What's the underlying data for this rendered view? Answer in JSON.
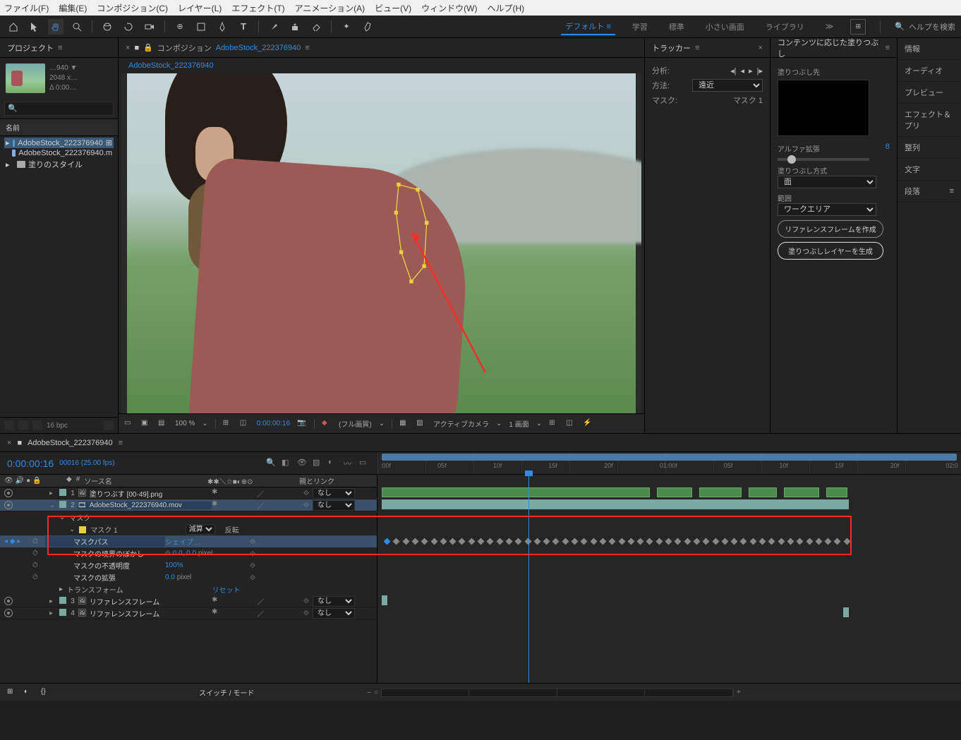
{
  "menu": {
    "file": "ファイル(F)",
    "edit": "編集(E)",
    "comp": "コンポジション(C)",
    "layer": "レイヤー(L)",
    "effect": "エフェクト(T)",
    "anim": "アニメーション(A)",
    "view": "ビュー(V)",
    "window": "ウィンドウ(W)",
    "help": "ヘルプ(H)"
  },
  "workspace": {
    "default": "デフォルト",
    "learn": "学習",
    "standard": "標準",
    "small": "小さい画面",
    "library": "ライブラリ",
    "search_ph": "ヘルプを検索"
  },
  "project": {
    "title": "プロジェクト",
    "name_trunc": "…940 ▼",
    "dim": "2048 x…",
    "dur": "Δ 0:00…",
    "col_name": "名前",
    "items": [
      {
        "label": "AdobeStock_222376940",
        "sel": true,
        "kind": "comp"
      },
      {
        "label": "AdobeStock_222376940.m",
        "kind": "img"
      },
      {
        "label": "塗りのスタイル",
        "kind": "folder"
      }
    ],
    "bpc": "16 bpc"
  },
  "comp": {
    "prefix": "コンポジション",
    "name": "AdobeStock_222376940",
    "tab_name": "AdobeStock_222376940"
  },
  "viewer_ctrl": {
    "zoom": "100 %",
    "time": "0:00:00:16",
    "quality": "(フル画質)",
    "camera": "アクティブカメラ",
    "views": "1 画面"
  },
  "tracker": {
    "title": "トラッカー",
    "analysis": "分析:",
    "method": "方法:",
    "method_val": "遠近",
    "mask": "マスク:",
    "mask_val": "マスク 1"
  },
  "fill": {
    "title": "コンテンツに応じた塗りつぶし",
    "target": "塗りつぶし先",
    "alpha": "アルファ拡張",
    "alpha_val": "8",
    "method": "塗りつぶし方式",
    "method_val": "面",
    "range": "範囲",
    "range_val": "ワークエリア",
    "btn_ref": "リファレンスフレームを作成",
    "btn_gen": "塗りつぶしレイヤーを生成"
  },
  "right_tabs": [
    "情報",
    "オーディオ",
    "プレビュー",
    "エフェクト＆プリ",
    "整列",
    "文字",
    "段落"
  ],
  "timeline": {
    "tab": "AdobeStock_222376940",
    "time": "0:00:00:16",
    "frame": "00016 (25.00 fps)",
    "ticks": [
      ":00f",
      "05f",
      "10f",
      "15f",
      "20f",
      "01:00f",
      "05f",
      "10f",
      "15f",
      "20f",
      "02:0"
    ],
    "cols": {
      "source": "ソース名",
      "switches_l": "",
      "link": "親とリンク"
    },
    "none": "なし",
    "layers": [
      {
        "n": "1",
        "name": "塗りつぶす [00-49].png",
        "icon": "seq"
      },
      {
        "n": "2",
        "name": "AdobeStock_222376940.mov",
        "icon": "mov",
        "sel": true
      },
      {
        "n": "3",
        "name": "リファレンスフレーム",
        "icon": "ref"
      },
      {
        "n": "4",
        "name": "リファレンスフレーム",
        "icon": "ref"
      }
    ],
    "mask_group": "マスク",
    "mask_name": "マスク 1",
    "mask_mode": "減算",
    "mask_invert": "反転",
    "props": {
      "path": {
        "label": "マスクパス",
        "val": "シェイプ…"
      },
      "feather": {
        "label": "マスクの境界のぼかし",
        "val": "0.0, 0.0",
        "unit": "pixel"
      },
      "opacity": {
        "label": "マスクの不透明度",
        "val": "100%"
      },
      "expand": {
        "label": "マスクの拡張",
        "val": "0.0",
        "unit": "pixel"
      }
    },
    "transform": "トランスフォーム",
    "reset": "リセット",
    "footer": "スイッチ / モード"
  }
}
